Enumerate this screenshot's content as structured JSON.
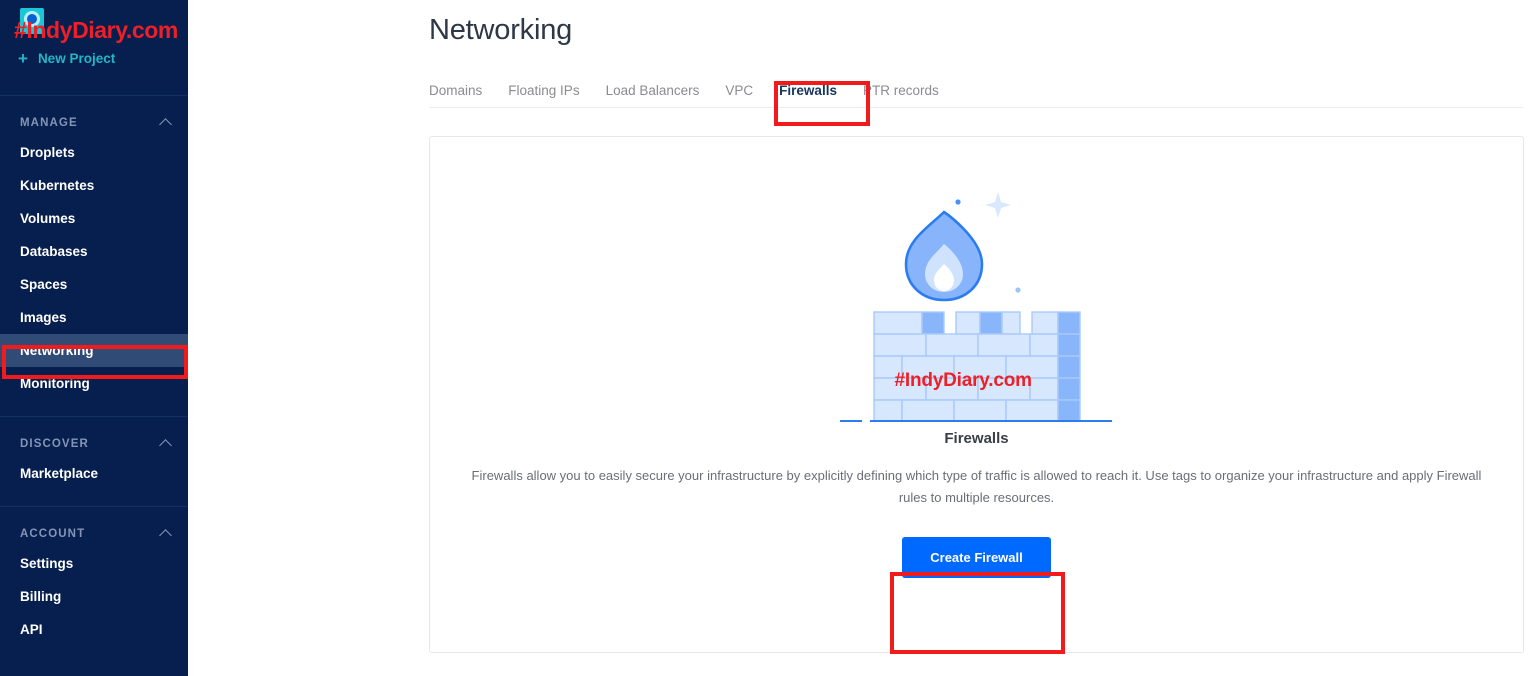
{
  "brand": {
    "watermark": "#IndyDiary.com",
    "logo_icon": "digitalocean-logo-icon",
    "new_project_label": "New Project",
    "new_project_icon": "plus-icon",
    "accent_cyan": "#23b6c8",
    "watermark_color": "#ed1f27"
  },
  "sidebar": {
    "background": "#071f4e",
    "active_background": "#314b77",
    "sections": [
      {
        "heading": "MANAGE",
        "chevron_icon": "chevron-up-icon",
        "items": [
          {
            "label": "Droplets",
            "active": false
          },
          {
            "label": "Kubernetes",
            "active": false
          },
          {
            "label": "Volumes",
            "active": false
          },
          {
            "label": "Databases",
            "active": false
          },
          {
            "label": "Spaces",
            "active": false
          },
          {
            "label": "Images",
            "active": false
          },
          {
            "label": "Networking",
            "active": true
          },
          {
            "label": "Monitoring",
            "active": false
          }
        ]
      },
      {
        "heading": "DISCOVER",
        "chevron_icon": "chevron-up-icon",
        "items": [
          {
            "label": "Marketplace",
            "active": false
          }
        ]
      },
      {
        "heading": "ACCOUNT",
        "chevron_icon": "chevron-up-icon",
        "items": [
          {
            "label": "Settings",
            "active": false
          },
          {
            "label": "Billing",
            "active": false
          },
          {
            "label": "API",
            "active": false
          }
        ]
      }
    ]
  },
  "page": {
    "title": "Networking"
  },
  "tabs": [
    {
      "label": "Domains",
      "active": false
    },
    {
      "label": "Floating IPs",
      "active": false
    },
    {
      "label": "Load Balancers",
      "active": false
    },
    {
      "label": "VPC",
      "active": false
    },
    {
      "label": "Firewalls",
      "active": true
    },
    {
      "label": "PTR records",
      "active": false
    }
  ],
  "empty_state": {
    "illustration_icon": "firewall-brick-wall-flame-illustration",
    "watermark": "#IndyDiary.com",
    "title": "Firewalls",
    "description": "Firewalls allow you to easily secure your infrastructure by explicitly defining which type of traffic is allowed to reach it. Use tags to organize your infrastructure and apply Firewall rules to multiple resources.",
    "create_button_label": "Create Firewall",
    "create_button_color": "#0069ff"
  },
  "annotations": {
    "color": "#f21b1b",
    "boxes": [
      {
        "target": "sidebar-item-networking"
      },
      {
        "target": "tab-firewalls"
      },
      {
        "target": "create-firewall-button"
      }
    ]
  }
}
